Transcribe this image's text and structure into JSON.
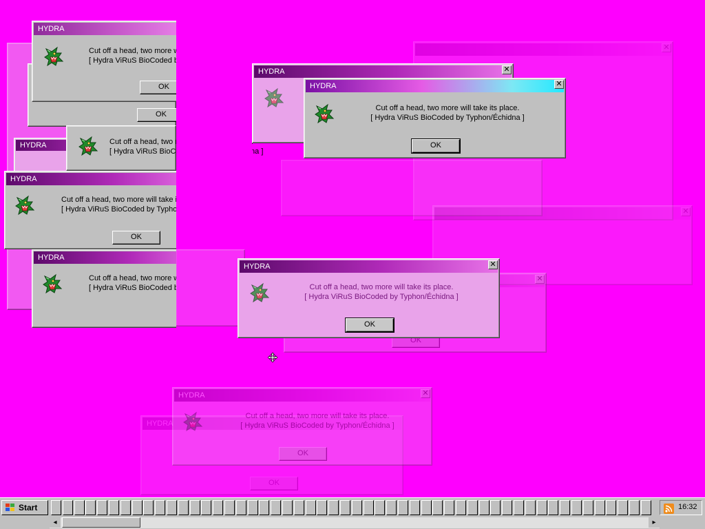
{
  "dialog": {
    "title": "HYDRA",
    "line1": "Cut off a head, two more will take its place.",
    "line2": "[ Hydra ViRuS BioCoded by Typhon/Échidna ]",
    "ok_label": "OK",
    "close_glyph": "✕"
  },
  "icons": {
    "dialog_icon": "green-dragon-head-icon",
    "start_logo": "windows-flag-icon",
    "tray_icon": "rss-feed-icon",
    "cursor": "move-cursor-icon"
  },
  "taskbar": {
    "start_label": "Start",
    "clock": "16:32",
    "scroll_left": "◂",
    "scroll_right": "▸"
  },
  "colors": {
    "desktop": "#fe00fe",
    "title_active_start": "#7a10a4",
    "title_active_end": "#22e8ff",
    "title_inactive": "#5c0a6a"
  }
}
